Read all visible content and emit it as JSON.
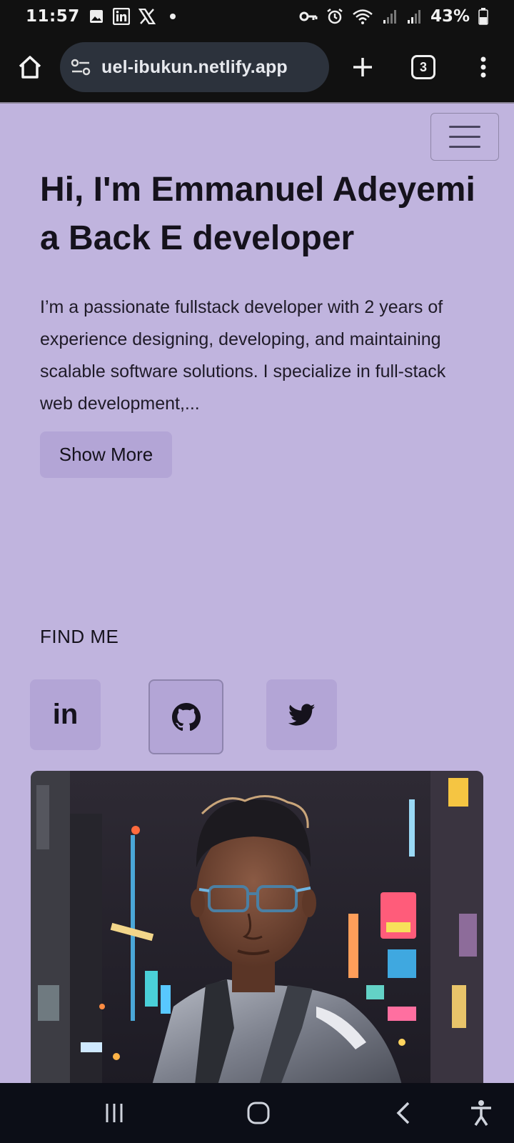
{
  "status_bar": {
    "time": "11:57",
    "battery": "43%",
    "icons": [
      "gallery-icon",
      "linkedin-notification-icon",
      "x-notification-icon",
      "dot-icon",
      "vpn-key-icon",
      "alarm-icon",
      "wifi-icon",
      "signal-icon",
      "signal-icon",
      "battery-icon"
    ]
  },
  "browser": {
    "url": "uel-ibukun.netlify.app",
    "tab_count": "3",
    "icons": [
      "home-icon",
      "site-settings-icon",
      "plus-icon",
      "more-vert-icon"
    ]
  },
  "page": {
    "hero_title": "Hi, I'm Emmanuel Adeyemi a Back E developer",
    "hero_description": "I’m a passionate fullstack developer with 2 years of experience designing, developing, and maintaining scalable software solutions. I specialize in full-stack web development,...",
    "show_more_label": "Show More",
    "find_me_label": "FIND ME",
    "social": {
      "linkedin_label": "in",
      "icons": [
        "linkedin-icon",
        "github-icon",
        "twitter-icon"
      ]
    },
    "colors": {
      "background": "#c0b4de",
      "button_bg": "#b3a5d6",
      "text": "#15121c"
    }
  },
  "nav_bar": {
    "icons": [
      "recents-icon",
      "home-circle-icon",
      "back-icon",
      "accessibility-icon"
    ]
  }
}
